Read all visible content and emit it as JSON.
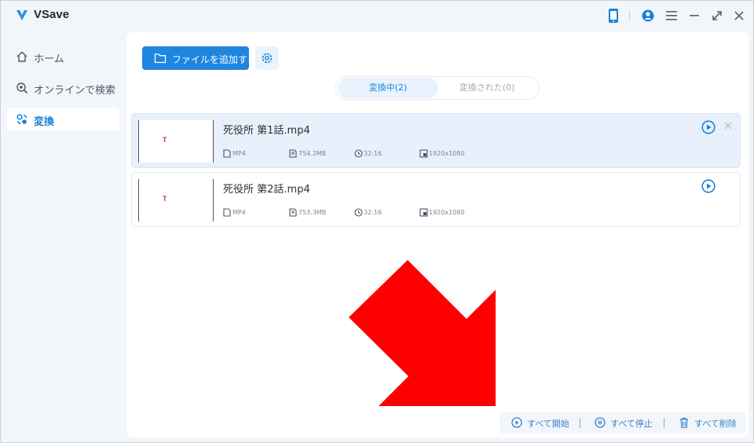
{
  "app": {
    "title": "VSave"
  },
  "sidebar": {
    "items": [
      {
        "label": "ホーム",
        "icon": "home-icon",
        "active": false
      },
      {
        "label": "オンラインで検索",
        "icon": "search-icon",
        "active": false
      },
      {
        "label": "変換",
        "icon": "convert-icon",
        "active": true
      }
    ]
  },
  "toolbar": {
    "add_file_label": "ファイルを追加する"
  },
  "tabs": [
    {
      "label": "変換中(2)",
      "active": true
    },
    {
      "label": "変換された(0)",
      "active": false
    }
  ],
  "files": [
    {
      "name": "死役所 第1話.mp4",
      "format": "MP4",
      "size": "754.2MB",
      "duration": "32:16",
      "resolution": "1920x1080",
      "thumb_text": "T"
    },
    {
      "name": "死役所 第2話.mp4",
      "format": "MP4",
      "size": "753.3MB",
      "duration": "32:16",
      "resolution": "1920x1080",
      "thumb_text": "T"
    }
  ],
  "bottom": {
    "start_all": "すべて開始",
    "stop_all": "すべて停止",
    "delete_all": "すべて削除"
  },
  "colors": {
    "accent": "#1f86e0",
    "annotation_arrow": "#ff0000"
  }
}
